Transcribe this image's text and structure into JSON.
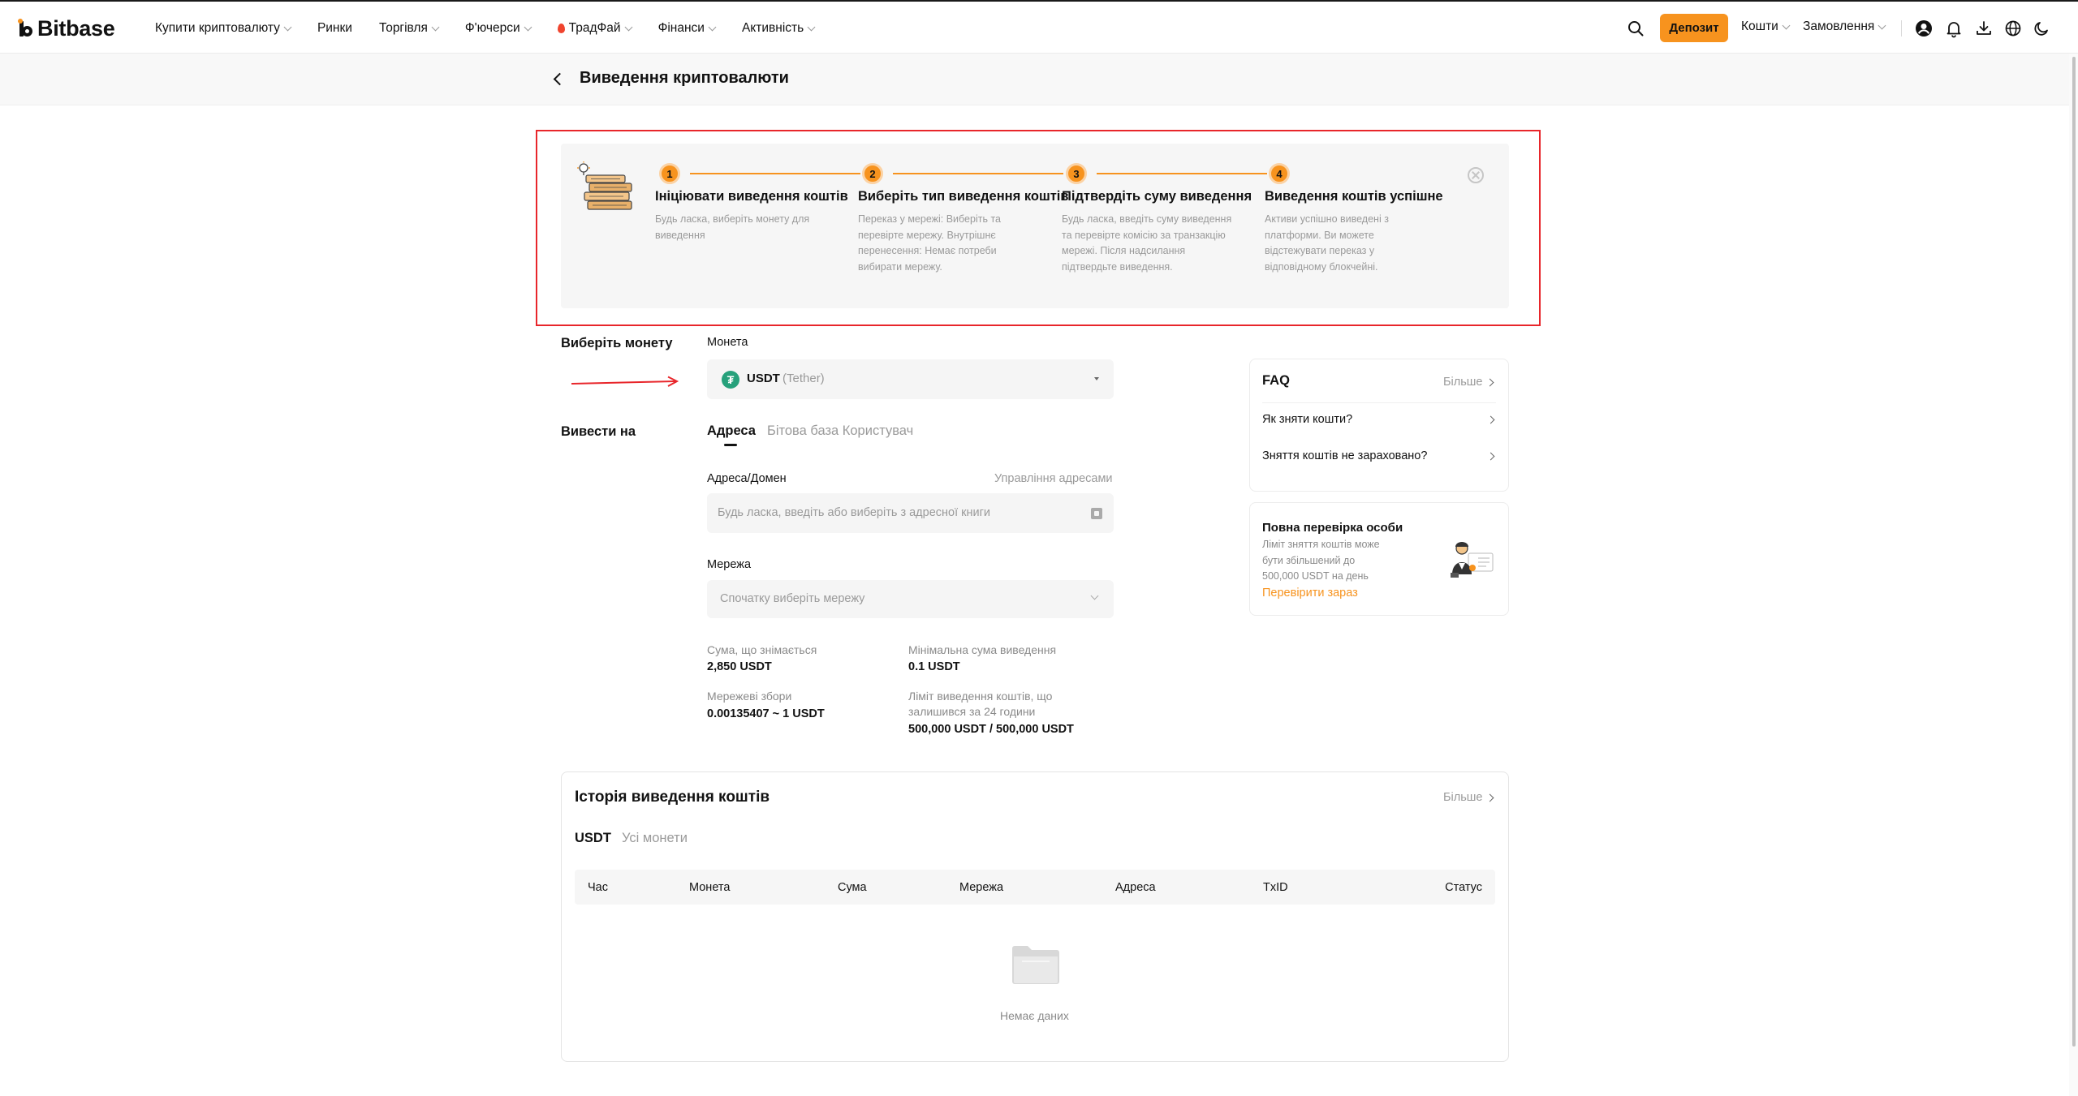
{
  "brand": {
    "name": "Bitbase",
    "accent": "#f7931e",
    "highlight_frame": "#e8262b"
  },
  "nav": {
    "items": [
      {
        "label": "Купити криптовалюту",
        "dropdown": true
      },
      {
        "label": "Ринки",
        "dropdown": false
      },
      {
        "label": "Торгівля",
        "dropdown": true
      },
      {
        "label": "Ф'ючерси",
        "dropdown": true
      },
      {
        "label": "ТрадФай",
        "dropdown": true,
        "icon": "flame-icon"
      },
      {
        "label": "Фінанси",
        "dropdown": true
      },
      {
        "label": "Активність",
        "dropdown": true
      }
    ],
    "deposit_label": "Депозит",
    "funds_label": "Кошти",
    "orders_label": "Замовлення",
    "icons": [
      "search-icon",
      "user-icon",
      "bell-icon",
      "download-icon",
      "globe-icon",
      "moon-icon"
    ]
  },
  "page": {
    "title": "Виведення криптовалюти"
  },
  "steps": [
    {
      "num": "1",
      "title": "Ініціювати виведення коштів",
      "desc": "Будь ласка, виберіть монету для виведення"
    },
    {
      "num": "2",
      "title": "Виберіть тип виведення коштів",
      "desc": "Переказ у мережі: Виберіть та перевірте мережу. Внутрішнє перенесення: Немає потреби вибирати мережу."
    },
    {
      "num": "3",
      "title": "Підтвердіть суму виведення",
      "desc": "Будь ласка, введіть суму виведення та перевірте комісію за транзакцію мережі. Після надсилання підтвердьте виведення."
    },
    {
      "num": "4",
      "title": "Виведення коштів успішне",
      "desc": "Активи успішно виведені з платформи. Ви можете відстежувати переказ у відповідному блокчейні."
    }
  ],
  "form": {
    "select_coin_label": "Виберіть монету",
    "coin_label": "Монета",
    "coin": {
      "code": "USDT",
      "name": "(Tether)",
      "icon": "tether-icon",
      "icon_color": "#26a17b"
    },
    "withdraw_to_label": "Вивести на",
    "tabs": [
      {
        "label": "Адреса",
        "active": true
      },
      {
        "label": "Бітова база Користувач",
        "active": false
      }
    ],
    "address_label": "Адреса/Домен",
    "manage_addresses": "Управління адресами",
    "address_placeholder": "Будь ласка, введіть або виберіть з адресної книги",
    "network_label": "Мережа",
    "network_placeholder": "Спочатку виберіть мережу",
    "info": {
      "withdrawable_label": "Сума, що знімається",
      "withdrawable_value": "2,850 USDT",
      "min_label": "Мінімальна сума виведення",
      "min_value": "0.1 USDT",
      "fee_label": "Мережеві збори",
      "fee_value": "0.00135407 ~ 1 USDT",
      "limit_label_line1": "Ліміт виведення коштів, що",
      "limit_label_line2": "залишився за 24 години",
      "limit_value": "500,000 USDT / 500,000 USDT"
    }
  },
  "faq": {
    "title": "FAQ",
    "more": "Більше",
    "items": [
      {
        "label": "Як зняти кошти?"
      },
      {
        "label": "Зняття коштів не зараховано?"
      }
    ]
  },
  "kyc": {
    "title": "Повна перевірка особи",
    "desc": "Ліміт зняття коштів може бути збільшений до 500,000 USDT на день",
    "link": "Перевірити зараз"
  },
  "history": {
    "title": "Історія виведення коштів",
    "more": "Більше",
    "tabs": [
      {
        "label": "USDT",
        "active": true
      },
      {
        "label": "Усі монети",
        "active": false
      }
    ],
    "columns": [
      "Час",
      "Монета",
      "Сума",
      "Мережа",
      "Адреса",
      "TxID",
      "Статус"
    ],
    "empty": "Немає даних"
  }
}
